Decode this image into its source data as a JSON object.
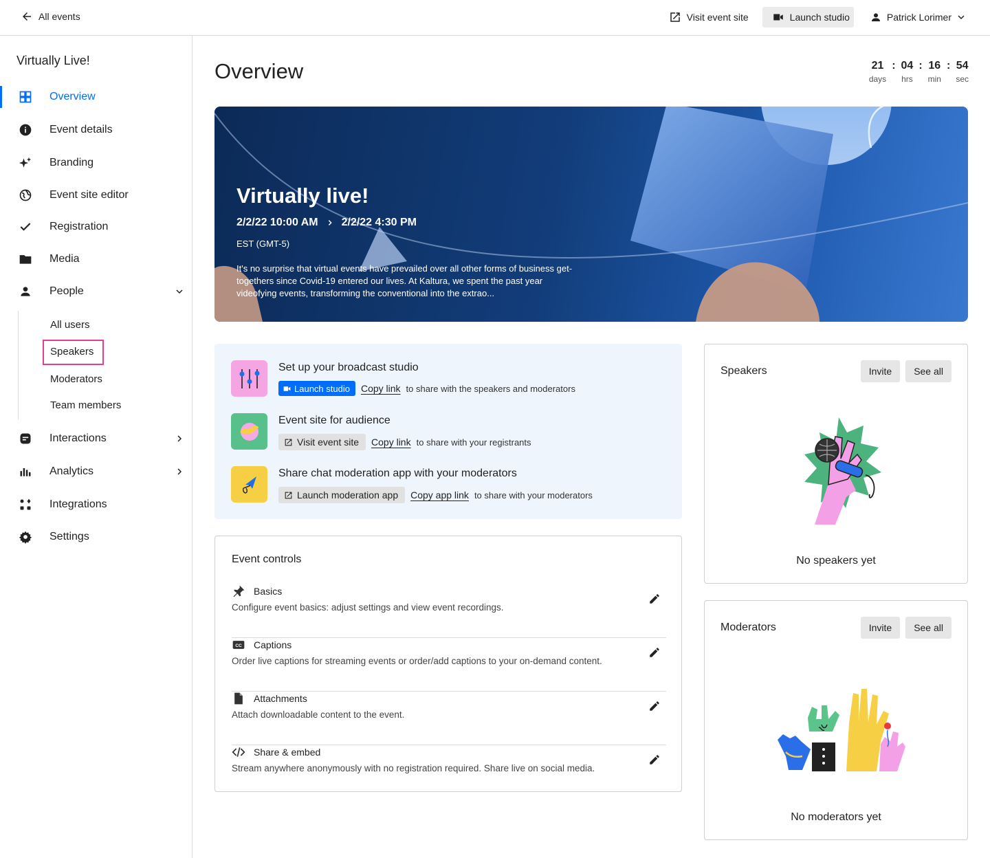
{
  "topbar": {
    "back_label": "All events",
    "visit_site_label": "Visit event site",
    "launch_studio_label": "Launch studio",
    "user_name": "Patrick Lorimer"
  },
  "sidebar": {
    "event_name": "Virtually Live!",
    "items": [
      {
        "label": "Overview",
        "icon": "grid-icon"
      },
      {
        "label": "Event details",
        "icon": "info-icon"
      },
      {
        "label": "Branding",
        "icon": "sparkle-icon"
      },
      {
        "label": "Event site editor",
        "icon": "globe-icon"
      },
      {
        "label": "Registration",
        "icon": "check-icon"
      },
      {
        "label": "Media",
        "icon": "folder-icon"
      },
      {
        "label": "People",
        "icon": "person-icon"
      },
      {
        "label": "Interactions",
        "icon": "chat-icon"
      },
      {
        "label": "Analytics",
        "icon": "bar-chart-icon"
      },
      {
        "label": "Integrations",
        "icon": "apps-icon"
      },
      {
        "label": "Settings",
        "icon": "gear-icon"
      }
    ],
    "people_sub": [
      "All users",
      "Speakers",
      "Moderators",
      "Team members"
    ]
  },
  "main": {
    "title": "Overview",
    "countdown": {
      "days": "21",
      "hrs": "04",
      "min": "16",
      "sec": "54",
      "days_label": "days",
      "hrs_label": "hrs",
      "min_label": "min",
      "sec_label": "sec"
    },
    "banner": {
      "title": "Virtually live!",
      "start": "2/2/22 10:00 AM",
      "end": "2/2/22 4:30 PM",
      "timezone": "EST (GMT-5)",
      "description": "It's no surprise that virtual events have prevailed over all other forms of business get-togethers since Covid-19 entered our lives. At Kaltura, we spent the past year videofying events, transforming the conventional into the extrao..."
    },
    "actions": [
      {
        "title": "Set up your broadcast studio",
        "button": "Launch studio",
        "link": "Copy link",
        "text": "to share with the speakers and moderators"
      },
      {
        "title": "Event site for audience",
        "button": "Visit event site",
        "link": "Copy link",
        "text": "to share with your registrants"
      },
      {
        "title": "Share chat moderation app with your moderators",
        "button": "Launch moderation app",
        "link": "Copy app link",
        "text": "to share with your moderators"
      }
    ],
    "controls": {
      "title": "Event controls",
      "items": [
        {
          "name": "Basics",
          "desc": "Configure event basics: adjust settings and view event recordings.",
          "icon": "pin-icon"
        },
        {
          "name": "Captions",
          "desc": "Order live captions for streaming events or order/add captions to your on-demand content.",
          "icon": "cc-icon"
        },
        {
          "name": "Attachments",
          "desc": "Attach downloadable content to the event.",
          "icon": "file-icon"
        },
        {
          "name": "Share & embed",
          "desc": "Stream anywhere anonymously with no registration required. Share live on social media.",
          "icon": "code-icon"
        }
      ]
    }
  },
  "speakers_card": {
    "title": "Speakers",
    "invite": "Invite",
    "see_all": "See all",
    "empty": "No speakers yet"
  },
  "moderators_card": {
    "title": "Moderators",
    "invite": "Invite",
    "see_all": "See all",
    "empty": "No moderators yet"
  },
  "colors": {
    "accent": "#006efa",
    "highlight": "#e2408e",
    "panel_bg": "#eef5fd"
  }
}
